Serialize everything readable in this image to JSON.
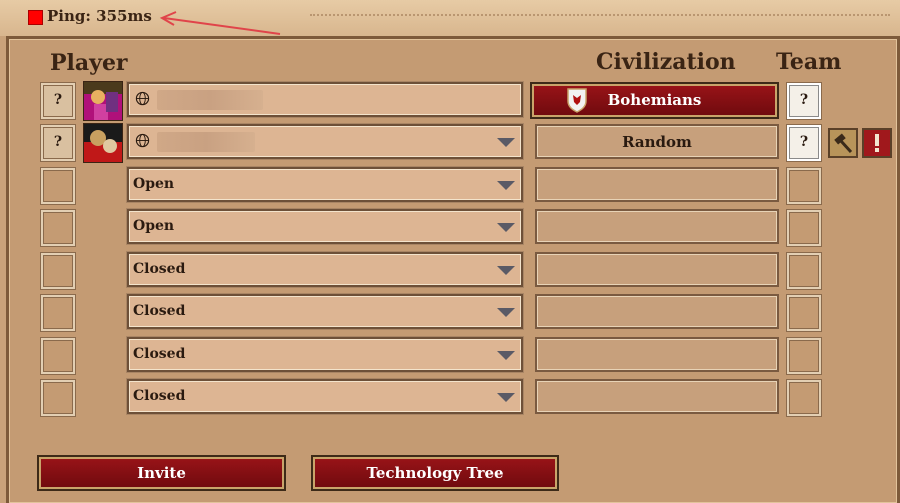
{
  "ping": {
    "label": "Ping: 355ms",
    "status_color": "#ff0000"
  },
  "headers": {
    "player": "Player",
    "civilization": "Civilization",
    "team": "Team"
  },
  "rows": [
    {
      "slot": "",
      "civ": "Bohemians",
      "team": "?",
      "player_q": "?",
      "type": "human-host"
    },
    {
      "slot": "",
      "civ": "Random",
      "team": "?",
      "player_q": "?",
      "type": "human"
    },
    {
      "slot": "Open",
      "civ": "",
      "team": "",
      "player_q": "",
      "type": "open"
    },
    {
      "slot": "Open",
      "civ": "",
      "team": "",
      "player_q": "",
      "type": "open"
    },
    {
      "slot": "Closed",
      "civ": "",
      "team": "",
      "player_q": "",
      "type": "closed"
    },
    {
      "slot": "Closed",
      "civ": "",
      "team": "",
      "player_q": "",
      "type": "closed"
    },
    {
      "slot": "Closed",
      "civ": "",
      "team": "",
      "player_q": "",
      "type": "closed"
    },
    {
      "slot": "Closed",
      "civ": "",
      "team": "",
      "player_q": "",
      "type": "closed"
    }
  ],
  "buttons": {
    "invite": "Invite",
    "tech_tree": "Technology Tree"
  },
  "icons": {
    "globe": "globe-icon",
    "dropdown": "chevron-down-icon",
    "shield": "bohemians-shield-icon",
    "kick": "hammer-icon",
    "report": "exclamation-icon"
  },
  "colors": {
    "accent_red": "#8a1014",
    "parchment": "#c49b73"
  }
}
